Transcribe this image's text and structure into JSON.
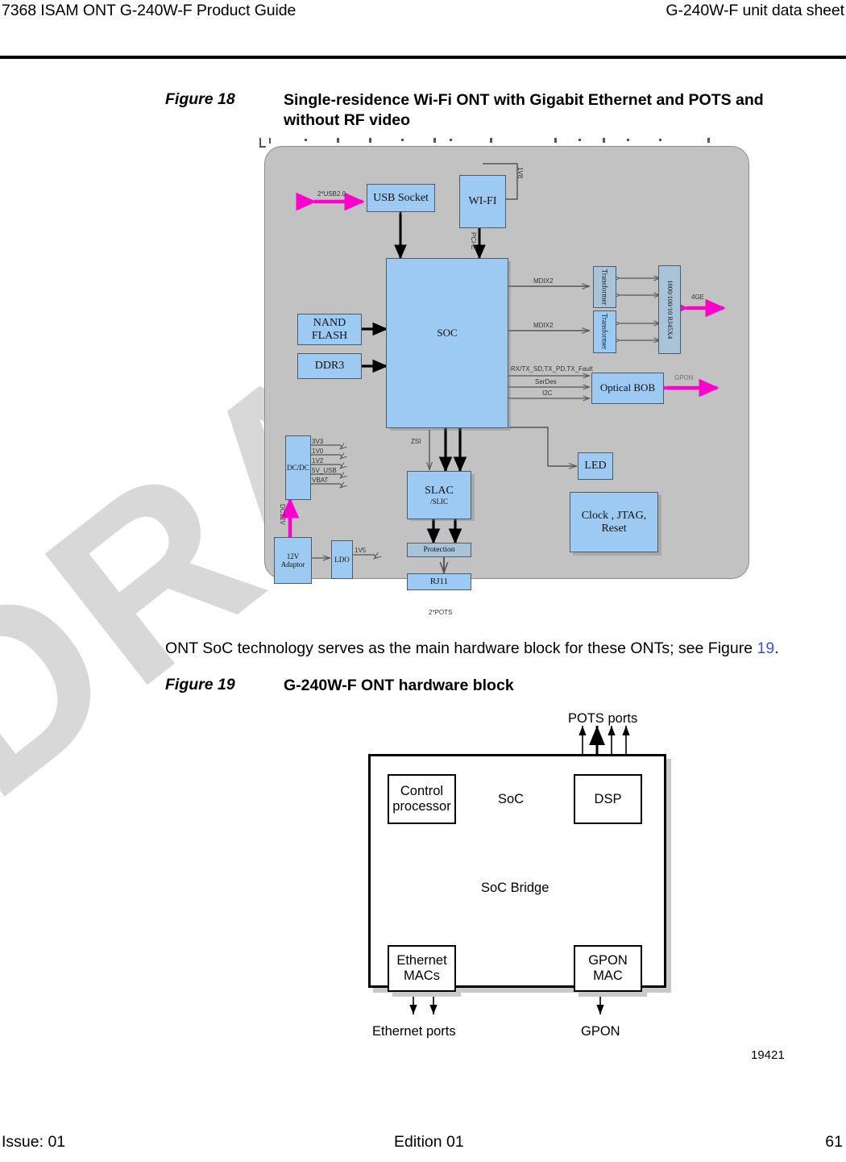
{
  "header": {
    "left": "7368 ISAM ONT G-240W-F Product Guide",
    "right": "G-240W-F unit data sheet"
  },
  "watermark": {
    "text": "DRAFT",
    "color": "#d8d8d8"
  },
  "figure18": {
    "label": "Figure 18",
    "title": "Single-residence Wi-Fi ONT with Gigabit Ethernet and POTS and without RF video",
    "blocks": {
      "usb_socket": "USB Socket",
      "wifi": "WI-FI",
      "soc": "SOC",
      "nand_flash": "NAND\nFLASH",
      "nand_flash_line1": "NAND",
      "nand_flash_line2": "FLASH",
      "ddr3": "DDR3",
      "transformer1": "Transformer",
      "transformer2": "Transformer",
      "rj45": "1000/100/10 RJ45X4",
      "optical_bob": "Optical BOB",
      "dcdc": "DC/DC",
      "adaptor_line1": "12V",
      "adaptor_line2": "Adaptor",
      "ldo": "LDO",
      "slac_line1": "SLAC",
      "slac_line2": "/SLIC",
      "protection": "Protection",
      "rj11": "RJ11",
      "led": "LED",
      "clock_jtag_reset": "Clock , JTAG, Reset"
    },
    "labels": {
      "usb_iface": "2*USB2.0",
      "wifi_power": "1V8",
      "pcie": "PCI-E",
      "mdix2_top": "MDIX2",
      "mdix2_bottom": "MDIX2",
      "four_ge": "4GE",
      "optical_signals": "RX/TX_SD,TX_PD,TX_Fault",
      "serdes": "SerDes",
      "i2c": "I2C",
      "gpon": "GPON",
      "rail_3v3": "3V3",
      "rail_1v0": "1V0",
      "rail_1v2": "1V2",
      "rail_5v_usb": "5V_USB",
      "rail_vbat": "VBAT",
      "dc12v": "DC12V",
      "ldo_out": "1V5",
      "zsi": "ZSI",
      "pots": "2*POTS"
    },
    "colors": {
      "board": "#c2c2c2",
      "block": "#9ccaf3",
      "accent_arrow": "#ff00cc"
    }
  },
  "body_text": {
    "part1": "ONT SoC technology serves as the main hardware block for these ONTs; see Figure ",
    "xref": "19",
    "part2": "."
  },
  "figure19": {
    "label": "Figure 19",
    "title": "G-240W-F ONT hardware block",
    "number": "19421",
    "blocks": {
      "control_processor_line1": "Control",
      "control_processor_line2": "processor",
      "soc": "SoC",
      "dsp": "DSP",
      "soc_bridge": "SoC Bridge",
      "ethernet_macs_line1": "Ethernet",
      "ethernet_macs_line2": "MACs",
      "gpon_mac_line1": "GPON",
      "gpon_mac_line2": "MAC"
    },
    "labels": {
      "pots_ports": "POTS ports",
      "ethernet_ports": "Ethernet ports",
      "gpon": "GPON"
    }
  },
  "footer": {
    "issue": "Issue: 01",
    "edition": "Edition 01",
    "page": "61"
  }
}
